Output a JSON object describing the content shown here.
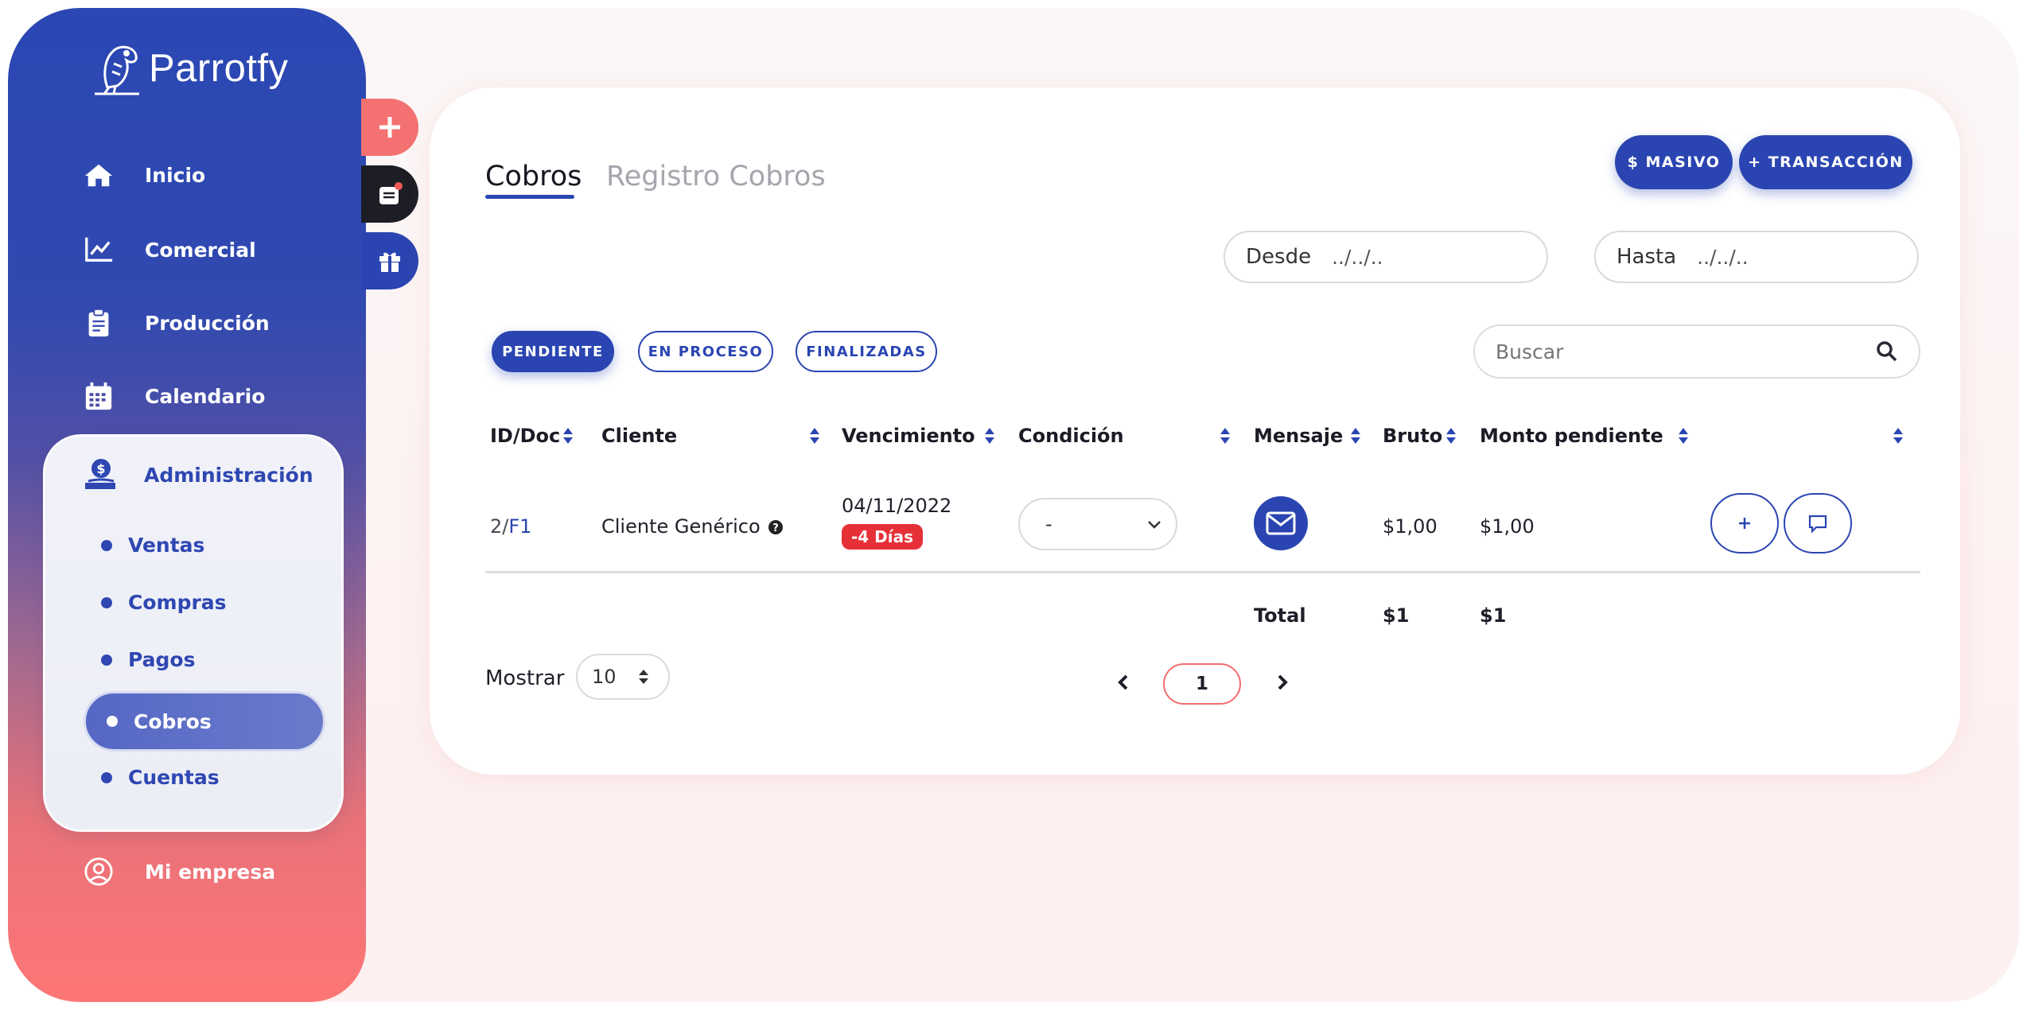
{
  "brand": {
    "name": "Parrotfy"
  },
  "sidebar": {
    "items": [
      {
        "label": "Inicio",
        "icon": "home-icon"
      },
      {
        "label": "Comercial",
        "icon": "chart-line-icon"
      },
      {
        "label": "Producción",
        "icon": "clipboard-icon"
      },
      {
        "label": "Calendario",
        "icon": "calendar-icon"
      }
    ],
    "admin": {
      "label": "Administración",
      "icon": "money-hand-icon",
      "subitems": [
        "Ventas",
        "Compras",
        "Pagos",
        "Cobros",
        "Cuentas"
      ],
      "active": "Cobros"
    },
    "company": {
      "label": "Mi empresa",
      "icon": "user-circle-icon"
    }
  },
  "fabs": [
    {
      "icon": "plus-icon",
      "color": "#f47171"
    },
    {
      "icon": "notification-inbox-icon",
      "color": "#1d1d25"
    },
    {
      "icon": "gift-icon",
      "color": "#2a45b1"
    }
  ],
  "tabs": {
    "active": "Cobros",
    "inactive": "Registro Cobros"
  },
  "actions": {
    "masivo": "$ MASIVO",
    "transaccion": "+ TRANSACCIÓN"
  },
  "filters": {
    "desde_label": "Desde",
    "desde_value": "../../..",
    "hasta_label": "Hasta",
    "hasta_value": "../../..",
    "status": [
      "PENDIENTE",
      "EN PROCESO",
      "FINALIZADAS"
    ],
    "status_active": "PENDIENTE",
    "search_placeholder": "Buscar"
  },
  "table": {
    "columns": [
      "ID/Doc",
      "Cliente",
      "Vencimiento",
      "Condición",
      "Mensaje",
      "Bruto",
      "Monto pendiente"
    ],
    "rows": [
      {
        "id": "2/",
        "doc": "F1",
        "cliente": "Cliente Genérico",
        "vencimiento": "04/11/2022",
        "badge": "-4 Días",
        "condicion": "-",
        "bruto": "$1,00",
        "monto_pendiente": "$1,00"
      }
    ],
    "total": {
      "label": "Total",
      "bruto": "$1",
      "monto_pendiente": "$1"
    }
  },
  "pagination": {
    "mostrar_label": "Mostrar",
    "page_size": "10",
    "current_page": "1"
  },
  "colors": {
    "primary": "#2a45b1",
    "accent": "#f47171",
    "danger": "#e63038"
  }
}
